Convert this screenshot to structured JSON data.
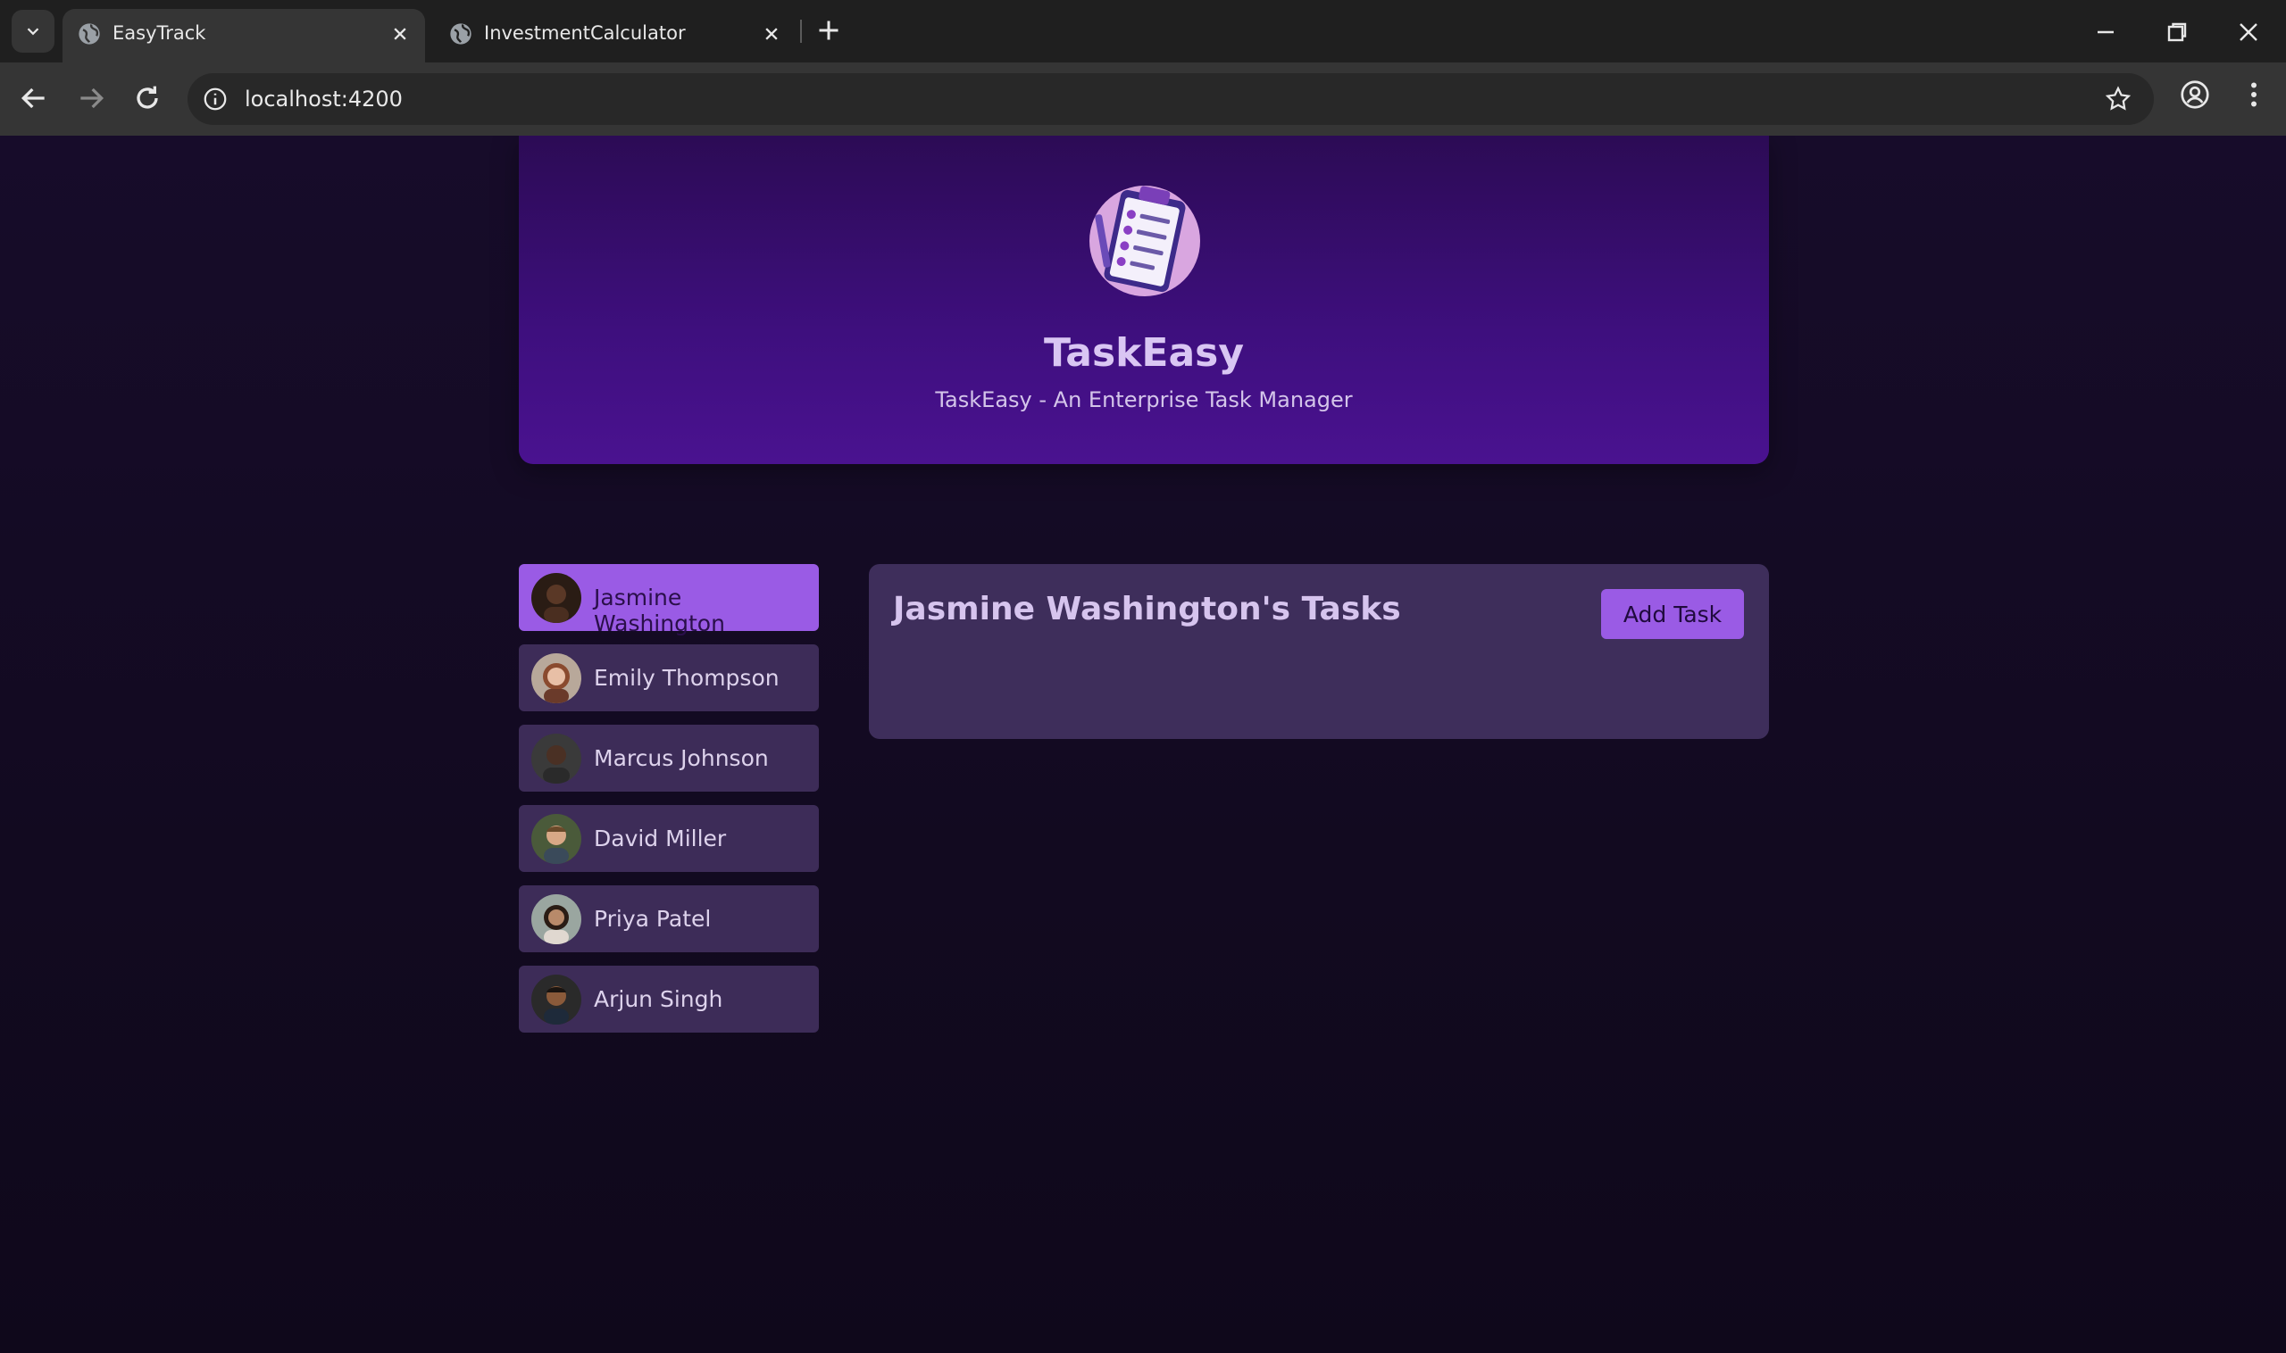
{
  "browser": {
    "tabs": [
      {
        "title": "EasyTrack",
        "active": true
      },
      {
        "title": "InvestmentCalculator",
        "active": false
      }
    ],
    "url": "localhost:4200"
  },
  "header": {
    "logo_icon": "clipboard-checklist-icon",
    "title": "TaskEasy",
    "subtitle": "TaskEasy - An Enterprise Task Manager"
  },
  "users": [
    {
      "name": "Jasmine Washington",
      "selected": true,
      "avatar_color": "#3a2418"
    },
    {
      "name": "Emily Thompson",
      "selected": false,
      "avatar_color": "#c98b6b"
    },
    {
      "name": "Marcus Johnson",
      "selected": false,
      "avatar_color": "#4a3024"
    },
    {
      "name": "David Miller",
      "selected": false,
      "avatar_color": "#8a6a4a"
    },
    {
      "name": "Priya Patel",
      "selected": false,
      "avatar_color": "#9a7a62"
    },
    {
      "name": "Arjun Singh",
      "selected": false,
      "avatar_color": "#5a3a28"
    }
  ],
  "tasks_panel": {
    "title": "Jasmine Washington's Tasks",
    "add_button": "Add Task"
  },
  "colors": {
    "accent": "#9a5be5",
    "header": "#3e0f7e",
    "panel": "#3e2e5b"
  }
}
